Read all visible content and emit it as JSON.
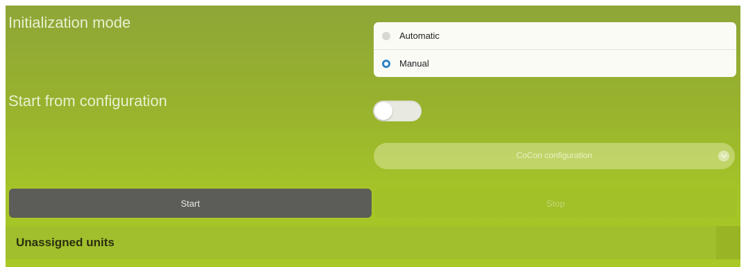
{
  "init_mode": {
    "label": "Initialization mode",
    "options": [
      {
        "label": "Automatic",
        "selected": false
      },
      {
        "label": "Manual",
        "selected": true
      }
    ]
  },
  "start_from_config": {
    "label": "Start from configuration",
    "enabled": false
  },
  "config_select": {
    "value": "CoCon configuration",
    "icon": "chevron-down-icon"
  },
  "actions": {
    "start_label": "Start",
    "stop_label": "Stop"
  },
  "units": {
    "title": "Unassigned units"
  },
  "colors": {
    "panel": "#a4c328",
    "start_button": "#5c5c58",
    "radio_selected": "#2f84c4"
  }
}
